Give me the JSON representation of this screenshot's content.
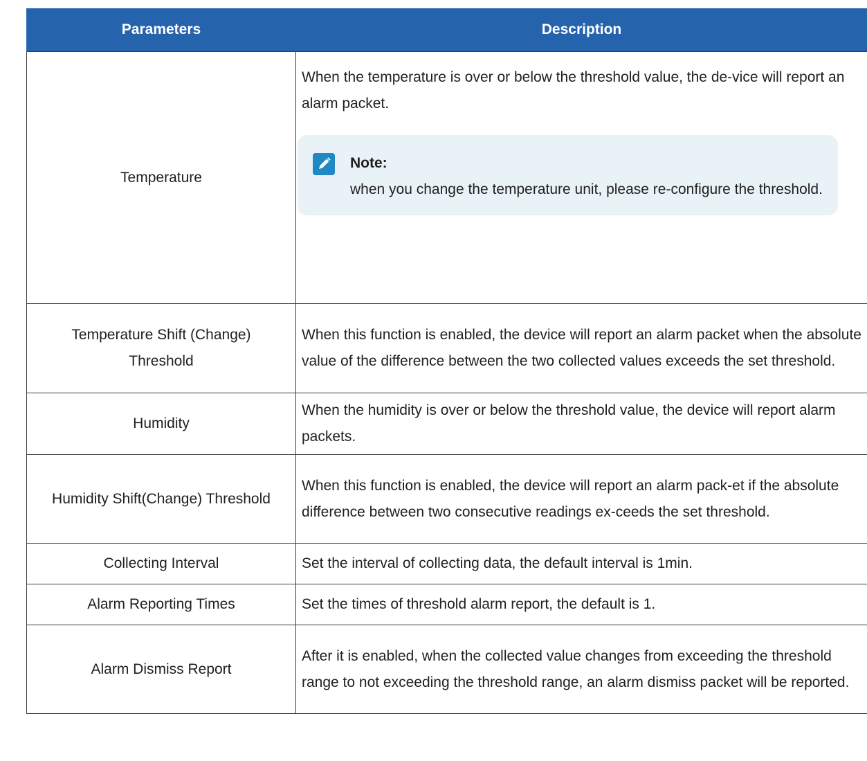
{
  "table": {
    "headers": {
      "parameters": "Parameters",
      "description": "Description"
    },
    "rows": [
      {
        "name": "Temperature",
        "description": "When the temperature is over or below the threshold value, the de-vice will report an alarm packet.",
        "note": {
          "icon": "note-pencil-icon",
          "title": "Note:",
          "text": "when you change the temperature unit, please re-configure the threshold."
        }
      },
      {
        "name": "Temperature Shift (Change) Threshold",
        "description": "When this function is enabled, the device will report an alarm packet when the absolute value of the difference between the two collected values exceeds the set threshold."
      },
      {
        "name": "Humidity",
        "description": "When the humidity is over or below the threshold value, the device will report alarm packets."
      },
      {
        "name": "Humidity Shift(Change) Threshold",
        "description": "When this function is enabled, the device will report an alarm pack-et if the absolute difference between two consecutive readings ex-ceeds the set threshold."
      },
      {
        "name": "Collecting Interval",
        "description": "Set the interval of collecting data, the default interval is 1min."
      },
      {
        "name": "Alarm Reporting Times",
        "description": "Set the times of threshold alarm report, the default is 1."
      },
      {
        "name": "Alarm Dismiss Report",
        "description": "After it is enabled, when the collected value changes from exceeding the threshold range to not exceeding the threshold range, an alarm dismiss packet will be reported."
      }
    ]
  },
  "colors": {
    "header_bg": "#2563ad",
    "note_bg": "#e9f2f7",
    "note_icon": "#1f88c5"
  }
}
